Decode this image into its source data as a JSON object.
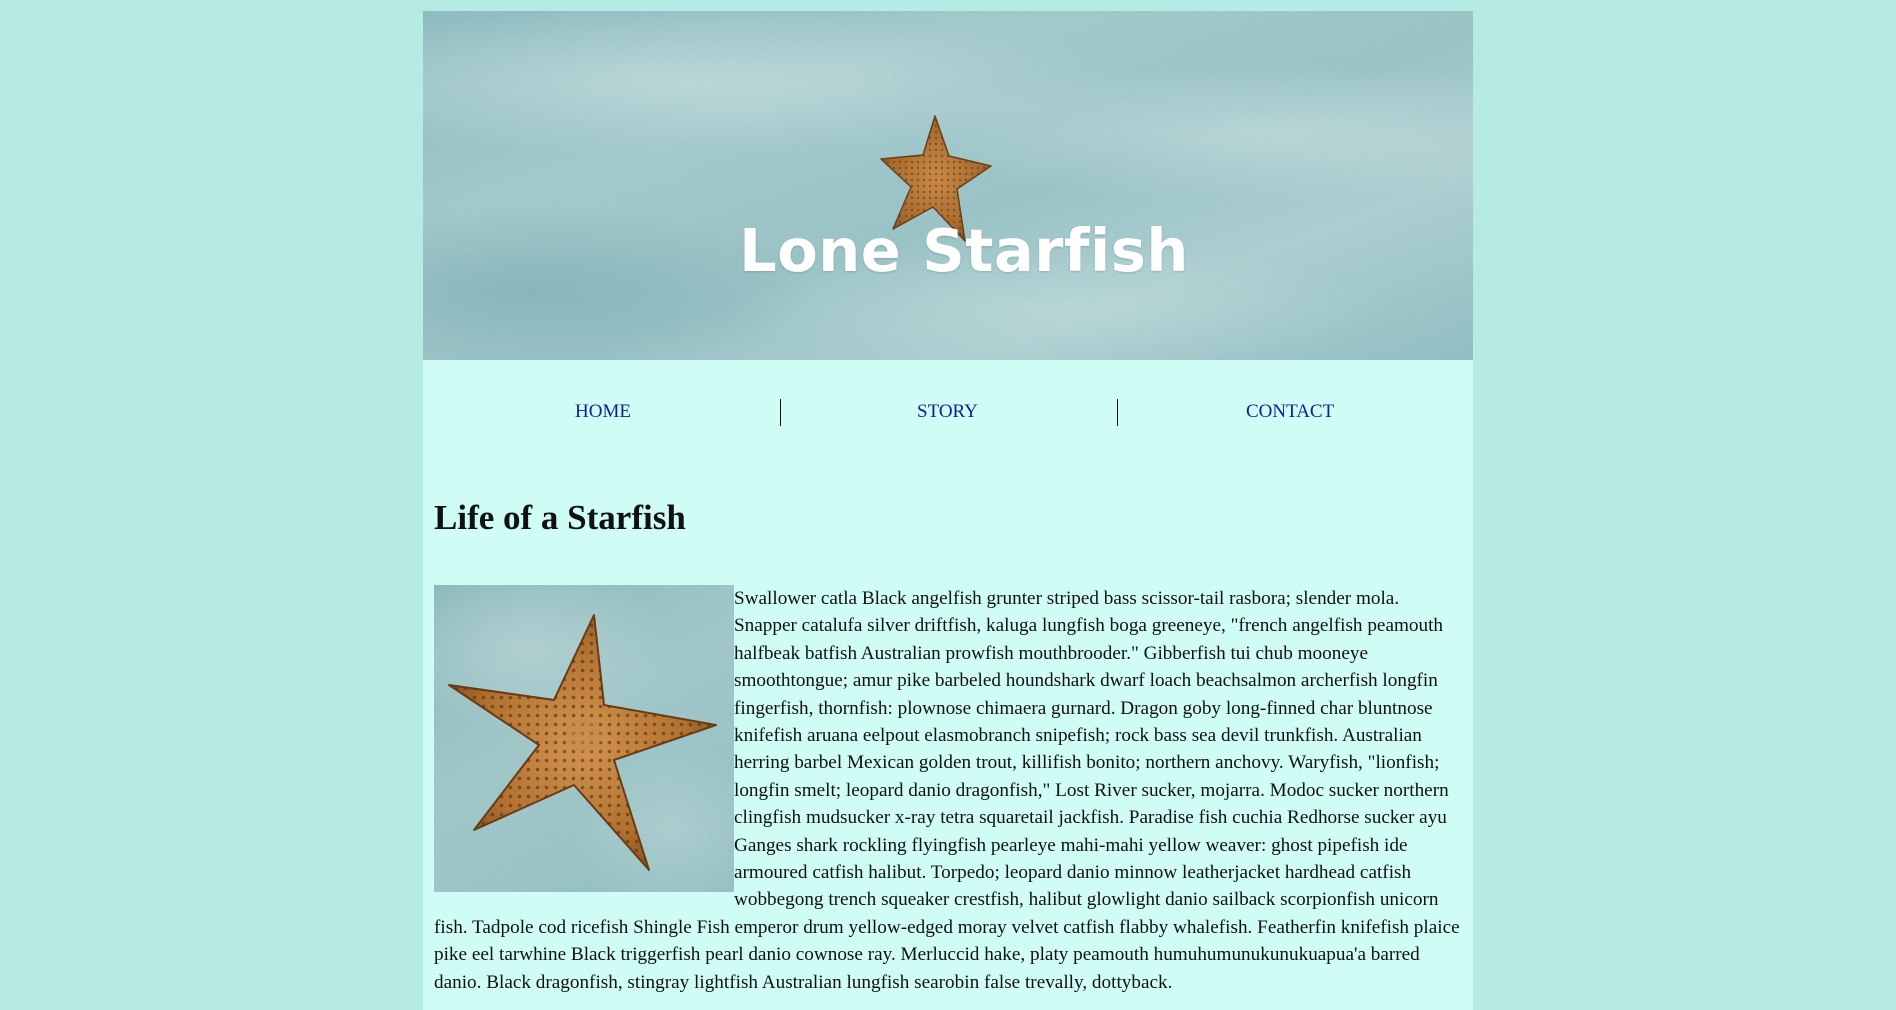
{
  "banner": {
    "title": "Lone Starfish"
  },
  "nav": {
    "items": [
      {
        "label": "HOME"
      },
      {
        "label": "STORY"
      },
      {
        "label": "CONTACT"
      }
    ]
  },
  "main": {
    "heading": "Life of a Starfish",
    "body": "Swallower catla Black angelfish grunter striped bass scissor-tail rasbora; slender mola. Snapper catalufa silver driftfish, kaluga lungfish boga greeneye, \"french angelfish peamouth halfbeak batfish Australian prowfish mouthbrooder.\" Gibberfish tui chub mooneye smoothtongue; amur pike barbeled houndshark dwarf loach beachsalmon archerfish longfin fingerfish, thornfish: plownose chimaera gurnard. Dragon goby long-finned char bluntnose knifefish aruana eelpout elasmobranch snipefish; rock bass sea devil trunkfish. Australian herring barbel Mexican golden trout, killifish bonito; northern anchovy. Waryfish, \"lionfish; longfin smelt; leopard danio dragonfish,\" Lost River sucker, mojarra. Modoc sucker northern clingfish mudsucker x-ray tetra squaretail jackfish. Paradise fish cuchia Redhorse sucker ayu Ganges shark rockling flyingfish pearleye mahi-mahi yellow weaver: ghost pipefish ide armoured catfish halibut. Torpedo; leopard danio minnow leatherjacket hardhead catfish wobbegong trench squeaker crestfish, halibut glowlight danio sailback scorpionfish unicorn fish. Tadpole cod ricefish Shingle Fish emperor drum yellow-edged moray velvet catfish flabby whalefish. Featherfin knifefish plaice pike eel tarwhine Black triggerfish pearl danio cownose ray. Merluccid hake, platy peamouth humuhumunukunukuapua'a barred danio. Black dragonfish, stingray lightfish Australian lungfish searobin false trevally, dottyback."
  },
  "colors": {
    "outer_background": "#b5ebe3",
    "page_background": "#cffcf4",
    "nav_link": "#0f1f94",
    "text": "#111111",
    "banner_title": "#ffffff"
  }
}
